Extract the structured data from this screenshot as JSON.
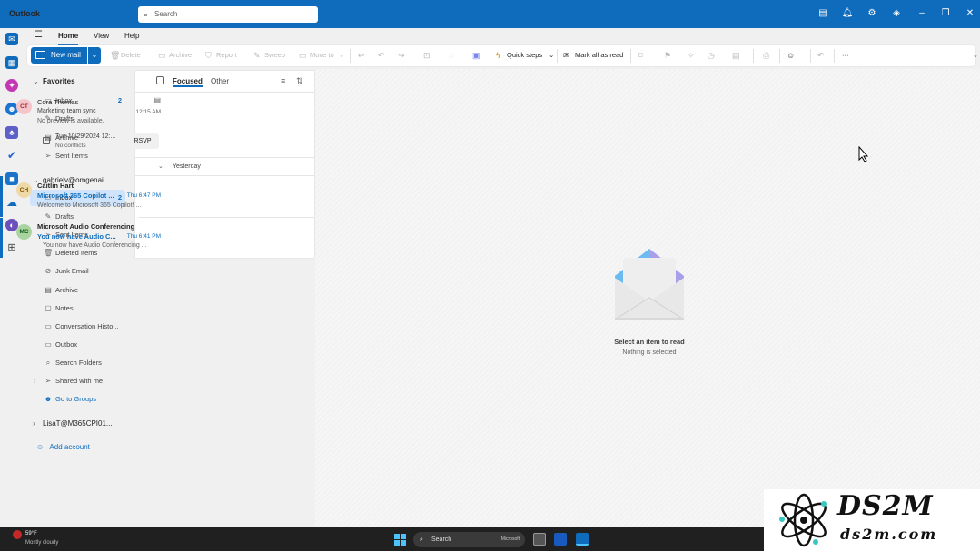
{
  "titlebar": {
    "app_name": "Outlook",
    "search_placeholder": "Search"
  },
  "ribbon": {
    "tabs": [
      "Home",
      "View",
      "Help"
    ],
    "new_mail": "New mail",
    "delete": "Delete",
    "archive": "Archive",
    "report": "Report",
    "sweep": "Sweep",
    "move_to": "Move to",
    "quick_steps": "Quick steps",
    "mark_all_read": "Mark all as read",
    "more": "···"
  },
  "folders": {
    "favorites_header": "Favorites",
    "favorites": [
      {
        "label": "Inbox",
        "count": "2",
        "icon": "inbox-icon"
      },
      {
        "label": "Drafts",
        "count": "",
        "icon": "pencil-icon"
      },
      {
        "label": "Archive",
        "count": "",
        "icon": "archive-icon"
      },
      {
        "label": "Sent Items",
        "count": "",
        "icon": "send-icon"
      }
    ],
    "account_header": "gabrielv@omgenai...",
    "account_folders": [
      {
        "label": "Inbox",
        "count": "2",
        "icon": "inbox-icon"
      },
      {
        "label": "Drafts",
        "count": "",
        "icon": "pencil-icon"
      },
      {
        "label": "Sent Items",
        "count": "",
        "icon": "send-icon"
      },
      {
        "label": "Deleted Items",
        "count": "",
        "icon": "trash-icon"
      },
      {
        "label": "Junk Email",
        "count": "",
        "icon": "junk-icon"
      },
      {
        "label": "Archive",
        "count": "",
        "icon": "archive-icon"
      },
      {
        "label": "Notes",
        "count": "",
        "icon": "note-icon"
      },
      {
        "label": "Conversation Histo...",
        "count": "",
        "icon": "folder-icon"
      },
      {
        "label": "Outbox",
        "count": "",
        "icon": "outbox-icon"
      },
      {
        "label": "Search Folders",
        "count": "",
        "icon": "search-folder-icon"
      },
      {
        "label": "Shared with me",
        "count": "",
        "icon": "shared-icon"
      },
      {
        "label": "Go to Groups",
        "count": "",
        "icon": "groups-icon"
      }
    ],
    "other_account": "LisaT@M365CPI01...",
    "add_account": "Add account"
  },
  "message_list": {
    "tab_focused": "Focused",
    "tab_other": "Other",
    "group_yesterday": "Yesterday",
    "pinned": {
      "initials": "CT",
      "sender": "Cora Thomas",
      "subject": "Marketing team sync",
      "preview": "No preview is available.",
      "time": "12:15 AM",
      "event_date": "Tue 10/29/2024 12:...",
      "event_status": "No conflicts",
      "rsvp": "RSVP"
    },
    "messages": [
      {
        "initials": "CH",
        "sender": "Caitlin Hart",
        "subject": "Microsoft 365 Copilot ...",
        "time": "Thu 6:47 PM",
        "preview": "Welcome to Microsoft 365 Copilot! ..."
      },
      {
        "initials": "MC",
        "sender": "Microsoft Audio Conferencing",
        "subject": "You now have Audio C...",
        "time": "Thu 6:41 PM",
        "preview": "You now have Audio Conferencing ..."
      }
    ]
  },
  "reading_pane": {
    "title": "Select an item to read",
    "subtitle": "Nothing is selected"
  },
  "taskbar": {
    "temperature": "59°F",
    "weather": "Mostly cloudy",
    "search": "Search",
    "search_brand": "Microsoft"
  },
  "watermark": {
    "title": "DS2M",
    "subtitle": "ds2m.com"
  },
  "colors": {
    "accent": "#0f6cbd",
    "selected": "#cfe4fa",
    "ct_avatar": "#f4c6cb",
    "ch_avatar": "#f0d9a8",
    "mc_avatar": "#a9d4a0"
  }
}
